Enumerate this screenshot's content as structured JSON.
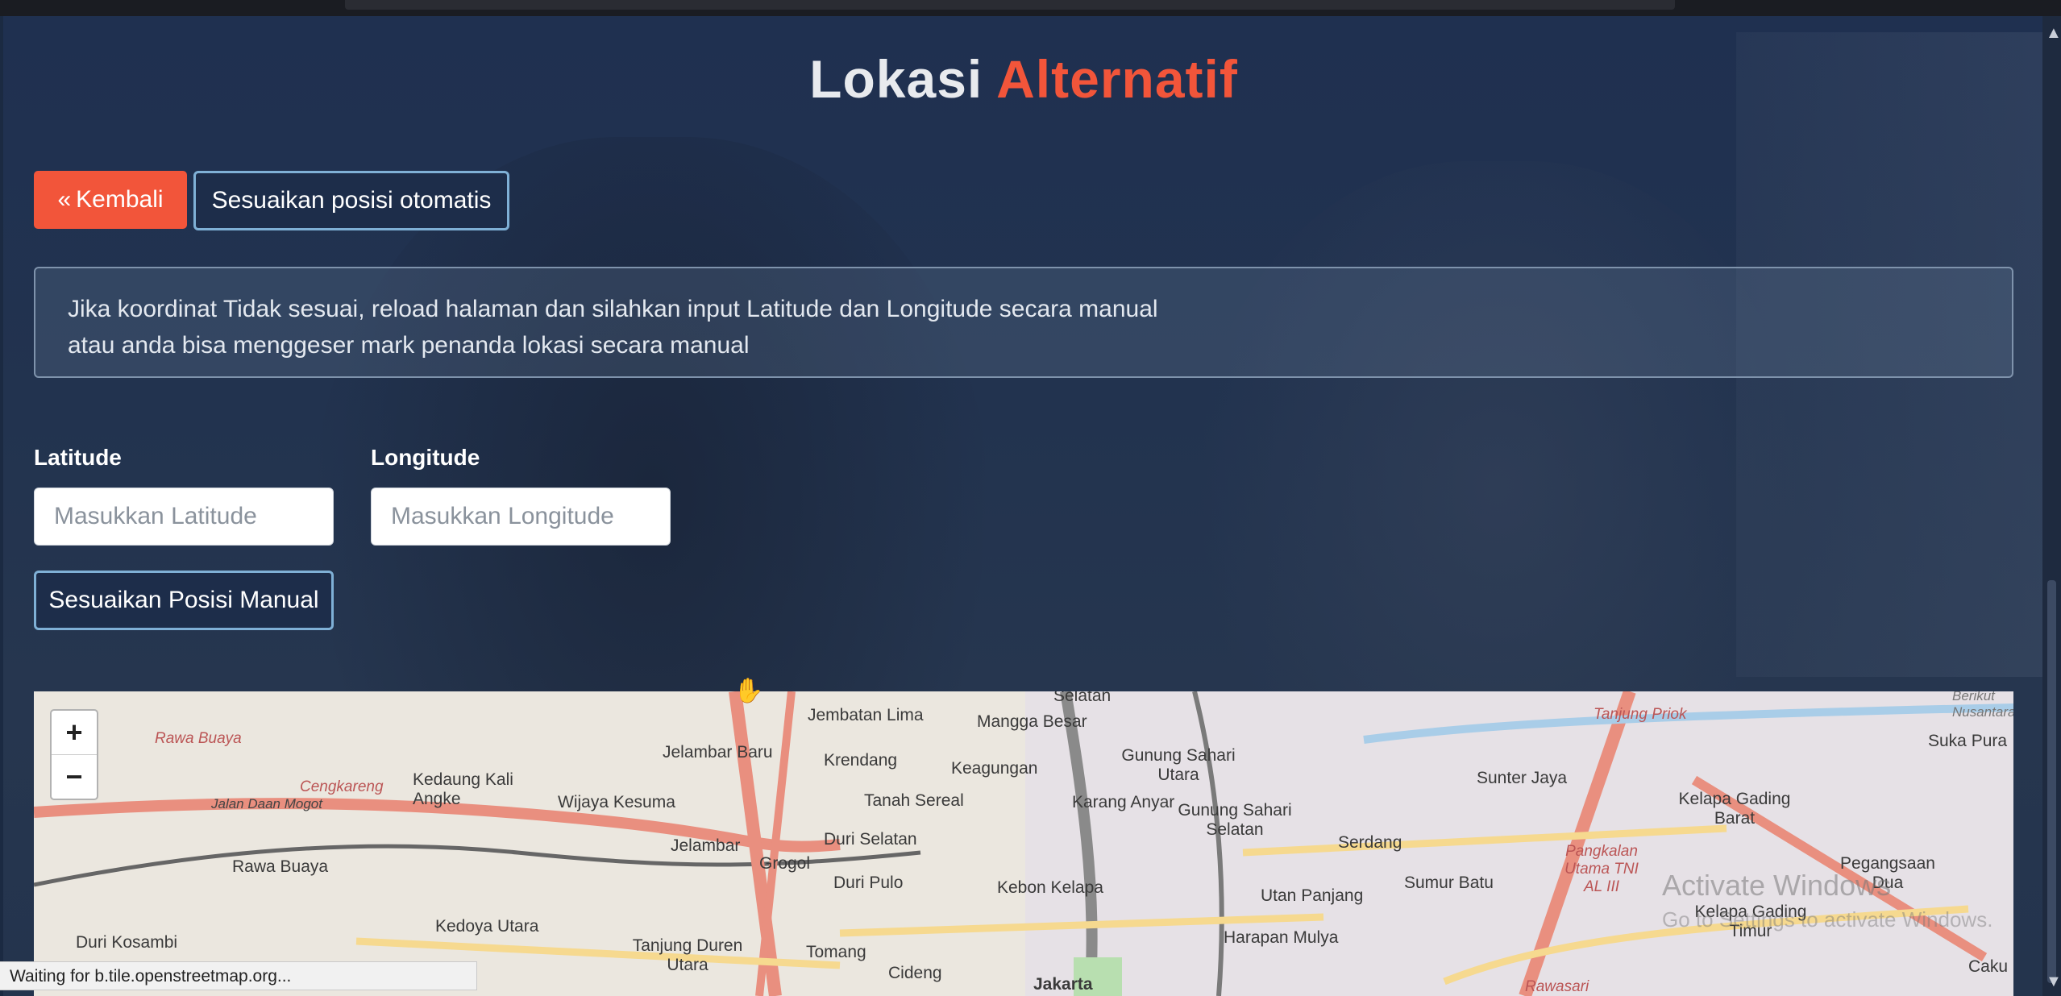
{
  "header": {
    "title_main": "Lokasi",
    "title_accent": "Alternatif"
  },
  "buttons": {
    "back_label": "Kembali",
    "auto_label": "Sesuaikan posisi otomatis",
    "manual_label": "Sesuaikan Posisi Manual"
  },
  "info": {
    "line1": "Jika koordinat Tidak sesuai, reload halaman dan silahkan input Latitude dan Longitude secara manual",
    "line2": "atau anda bisa menggeser mark penanda lokasi secara manual"
  },
  "form": {
    "latitude_label": "Latitude",
    "latitude_placeholder": "Masukkan Latitude",
    "latitude_value": "",
    "longitude_label": "Longitude",
    "longitude_placeholder": "Masukkan Longitude",
    "longitude_value": ""
  },
  "map": {
    "zoom_in": "+",
    "zoom_out": "−",
    "places": [
      "Rawa Buaya",
      "Kedaung Kali Angke",
      "Cengkareng",
      "Jalan Daan Mogot",
      "Wijaya Kesuma",
      "Jelambar Baru",
      "Jembatan Lima",
      "Mangga Besar",
      "Selatan",
      "Krendang",
      "Keagungan",
      "Tanah Sereal",
      "Karang Anyar",
      "Gunung Sahari Utara",
      "Gunung Sahari Selatan",
      "Jelambar",
      "Grogol",
      "Duri Selatan",
      "Duri Pulo",
      "Kebon Kelapa",
      "Jakarta",
      "Tanjung Priok",
      "Sunter Jaya",
      "Kelapa Gading Barat",
      "Suka Pura",
      "Serdang",
      "Sumur Batu",
      "Utan Panjang",
      "Harapan Mulya",
      "Pegangsaan Dua",
      "Kelapa Gading Timur",
      "Pangkalan Utama TNI AL III",
      "Rawa Buaya",
      "Duri Kosambi",
      "Kedoya Utara",
      "Tanjung Duren Utara",
      "Tomang",
      "Cideng",
      "Rawasari",
      "Berikut Nusantara",
      "Caku"
    ],
    "watermark_line1": "Activate Windows",
    "watermark_line2": "Go to Settings to activate Windows."
  },
  "status_text": "Waiting for b.tile.openstreetmap.org...",
  "colors": {
    "accent": "#f2553a",
    "outline": "#7fb0d6",
    "background": "#1f3050"
  }
}
